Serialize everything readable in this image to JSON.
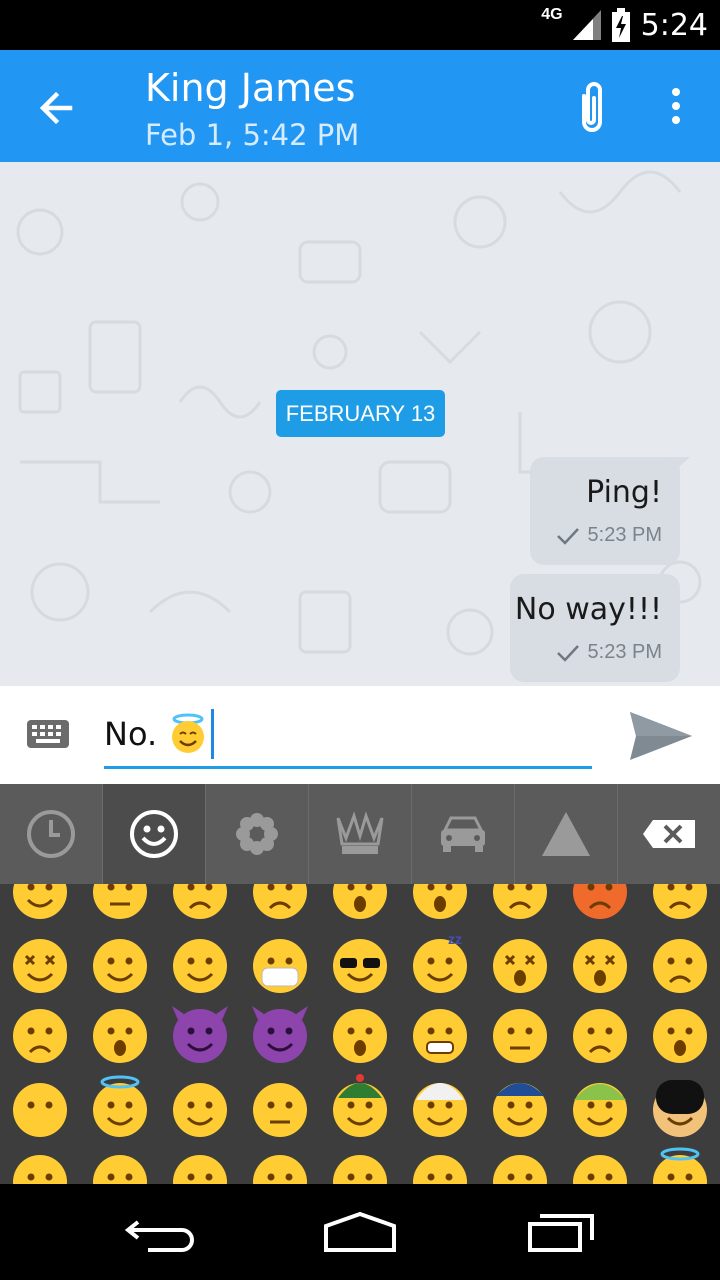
{
  "status_bar": {
    "network": "4G",
    "time": "5:24"
  },
  "header": {
    "contact_name": "King James",
    "last_seen": "Feb 1, 5:42 PM"
  },
  "chat": {
    "date_separator": "FEBRUARY 13",
    "messages": [
      {
        "text": "Ping!",
        "time": "5:23 PM",
        "status": "sent"
      },
      {
        "text": "No way!!!",
        "time": "5:23 PM",
        "status": "sent"
      }
    ]
  },
  "composer": {
    "value": "No.",
    "value_emoji": "smiling-face-with-halo"
  },
  "emoji_keyboard": {
    "tabs": [
      "recent-icon",
      "smiley-icon",
      "flower-icon",
      "crown-icon",
      "car-icon",
      "triangle-icon",
      "backspace-icon"
    ],
    "active_tab": "smiley-icon",
    "emoji_rows": [
      [
        "grinning-sweat",
        "unamused",
        "weary",
        "tired",
        "fearful",
        "scream",
        "angry",
        "pouting",
        "crying-loud"
      ],
      [
        "confounded",
        "laughing",
        "yum",
        "mask",
        "sunglasses",
        "sleeping",
        "dizzy",
        "astonished-x",
        "worried"
      ],
      [
        "frowning",
        "anguished",
        "smiling-imp",
        "imp",
        "open-mouth",
        "grimacing",
        "neutral",
        "confused",
        "hushed"
      ],
      [
        "no-mouth",
        "innocent",
        "smirk",
        "expressionless",
        "man-gua-pi-mao",
        "man-turban",
        "cop",
        "construction-worker",
        "guardsman"
      ],
      [
        "baby",
        "boy",
        "girl",
        "man",
        "woman",
        "older-man",
        "older-woman",
        "person-blond",
        "angel"
      ]
    ]
  },
  "colors": {
    "accent": "#2196f3",
    "chip": "#1e9de6",
    "bubble": "#d7dde3",
    "keyboard": "#3d3d3d"
  }
}
